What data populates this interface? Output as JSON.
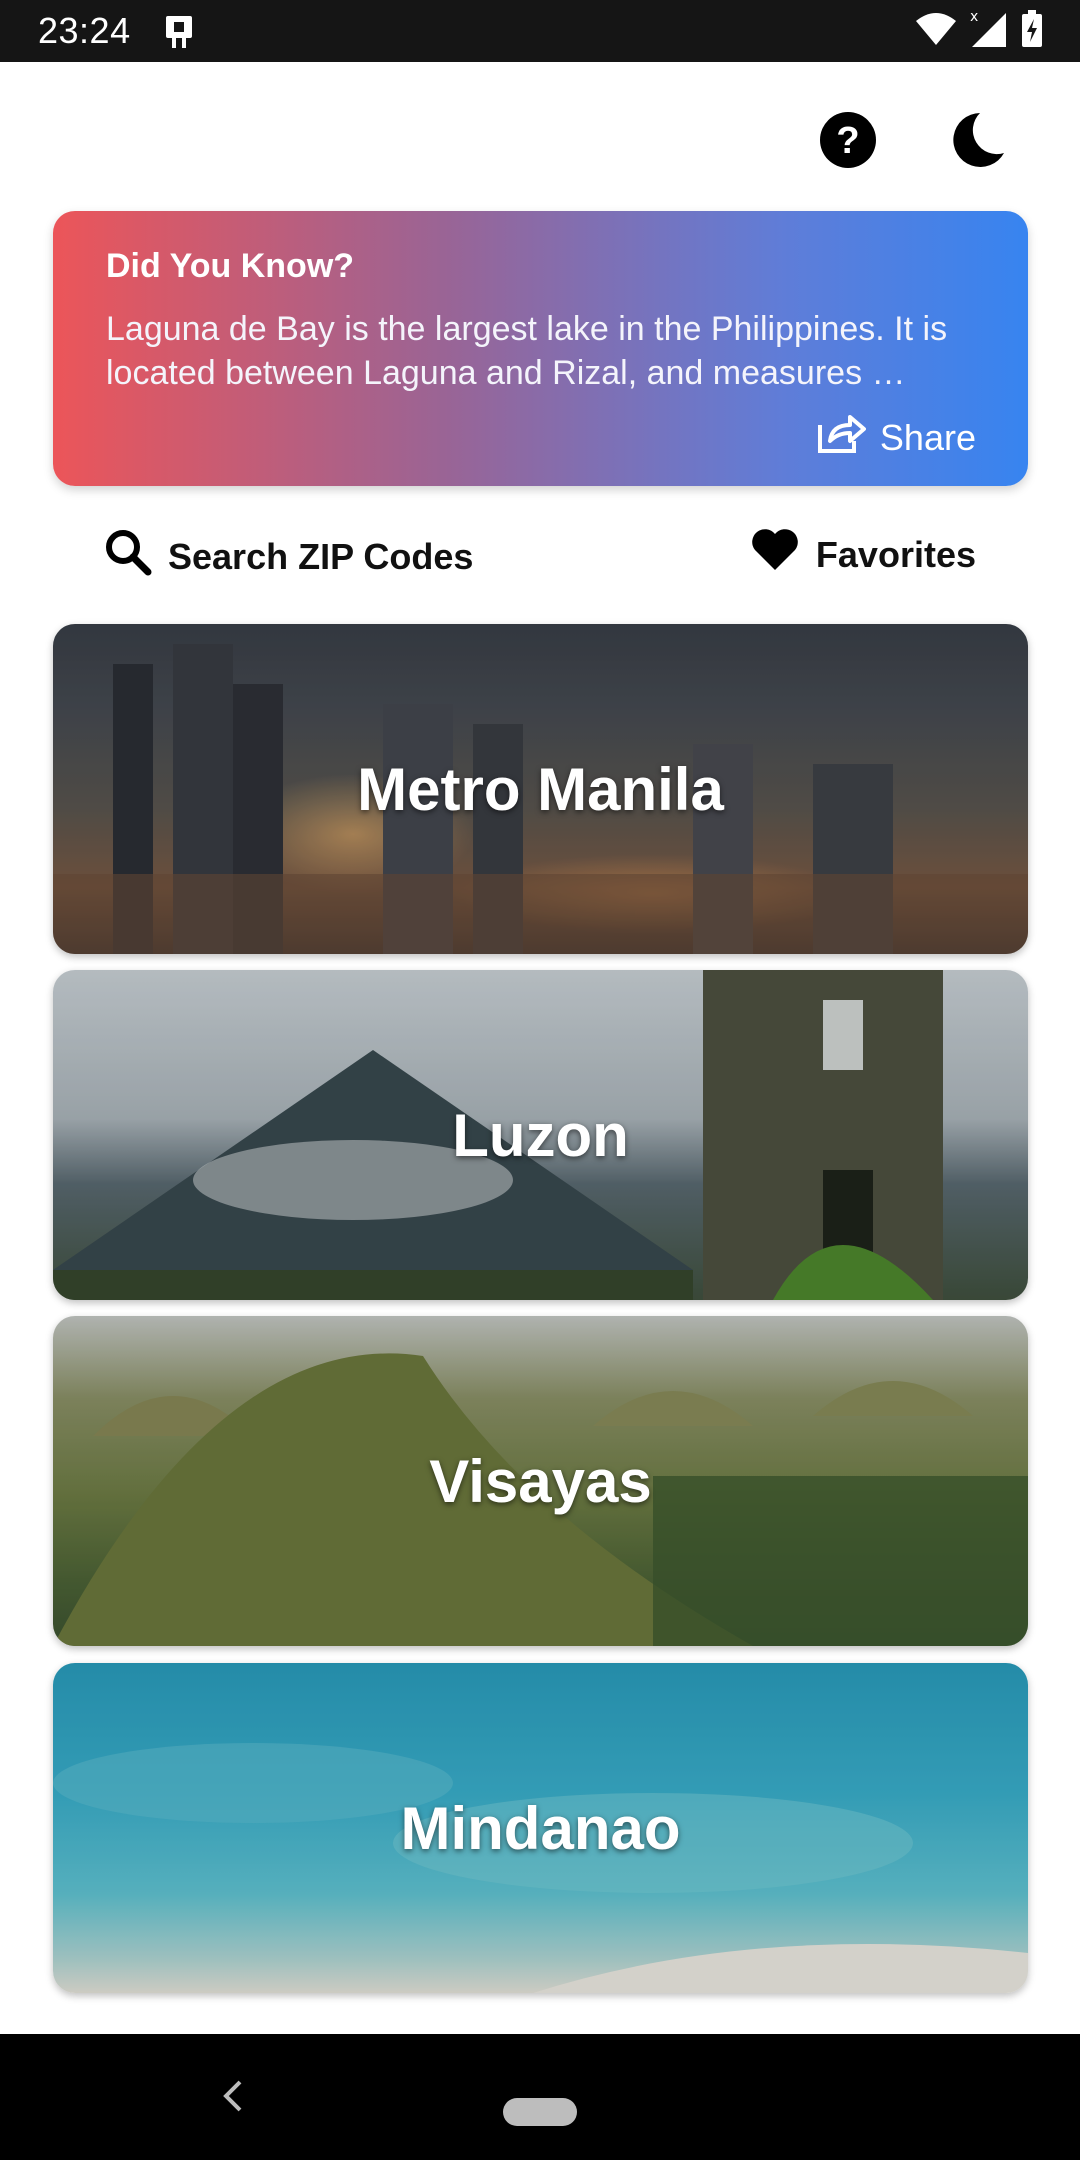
{
  "status_bar": {
    "time": "23:24",
    "left_icon": "device-icon",
    "right_icons": [
      "wifi-icon",
      "signal-icon",
      "battery-charging-icon"
    ]
  },
  "toolbar": {
    "help_icon": "help-circle-icon",
    "theme_icon": "moon-icon"
  },
  "fact_card": {
    "title": "Did You Know?",
    "body": "Laguna de Bay is the largest lake in the Philippines. It is located between Laguna and Rizal, and measures …",
    "share_label": "Share",
    "gradient_start": "#ec5559",
    "gradient_end": "#3784f0"
  },
  "nav": {
    "search_label": "Search ZIP Codes",
    "favorites_label": "Favorites"
  },
  "regions": [
    {
      "label": "Metro Manila"
    },
    {
      "label": "Luzon"
    },
    {
      "label": "Visayas"
    },
    {
      "label": "Mindanao"
    }
  ],
  "system_nav": {
    "back_icon": "chevron-left-icon",
    "home_icon": "home-pill-icon"
  }
}
